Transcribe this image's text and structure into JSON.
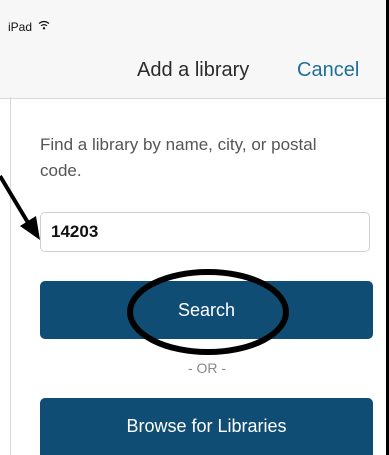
{
  "status_bar": {
    "device": "iPad"
  },
  "navbar": {
    "title": "Add a library",
    "cancel_label": "Cancel"
  },
  "form": {
    "hint": "Find a library by name, city, or postal code.",
    "search_value": "14203",
    "search_label": "Search",
    "or_label": "- OR -",
    "browse_label": "Browse for Libraries"
  },
  "colors": {
    "primary_button": "#0f4d74",
    "link": "#1f6f9a",
    "bar_background": "#f7f7f7"
  }
}
